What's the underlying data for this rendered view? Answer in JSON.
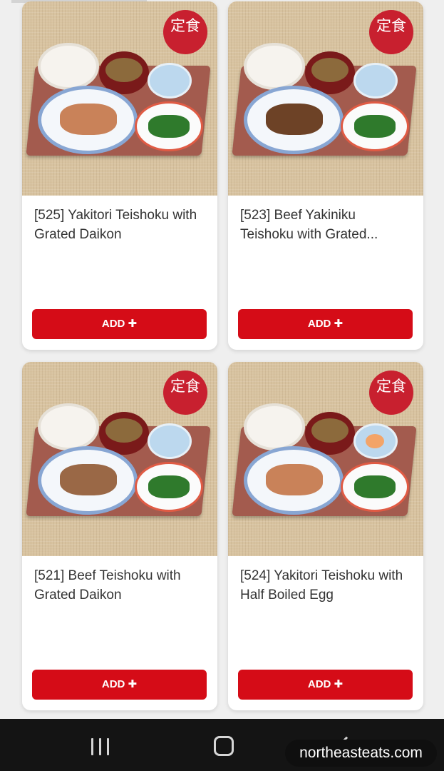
{
  "menu": {
    "items": [
      {
        "title": "[525] Yakitori Teishoku with Grated Daikon",
        "add_label": "ADD ✚",
        "seal_text": "定食"
      },
      {
        "title": "[523] Beef Yakiniku Teishoku with Grated...",
        "add_label": "ADD ✚",
        "seal_text": "定食"
      },
      {
        "title": "[521] Beef Teishoku with Grated Daikon",
        "add_label": "ADD ✚",
        "seal_text": "定食"
      },
      {
        "title": "[524] Yakitori Teishoku with Half Boiled Egg",
        "add_label": "ADD ✚",
        "seal_text": "定食"
      }
    ]
  },
  "nav": {
    "icons": [
      "recents-icon",
      "home-icon",
      "back-icon"
    ]
  },
  "watermark": "northeasteats.com",
  "colors": {
    "accent": "#d50c17",
    "navbar": "#141414"
  }
}
